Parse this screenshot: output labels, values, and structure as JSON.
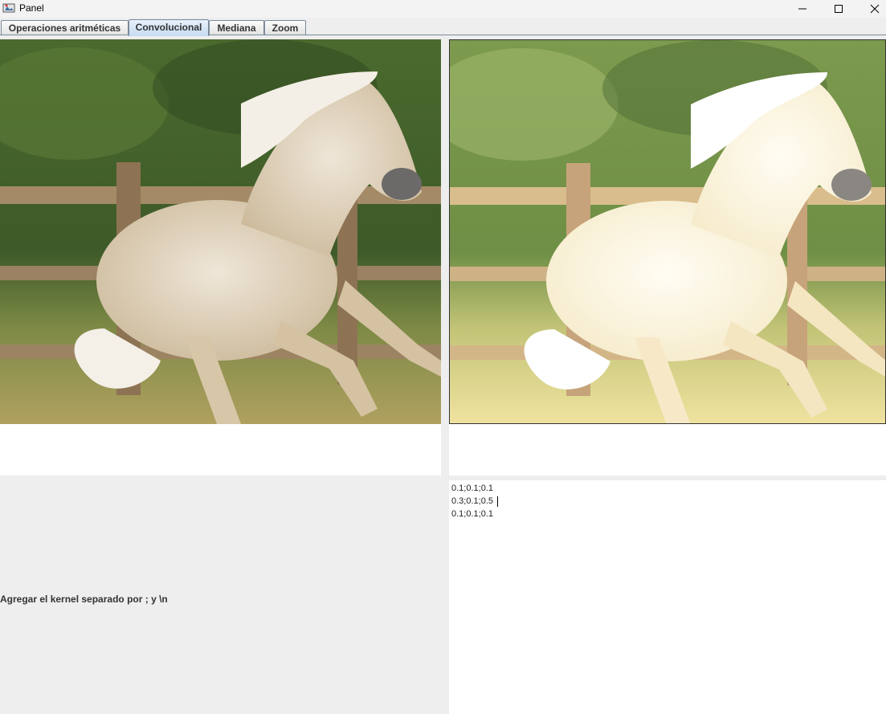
{
  "window": {
    "title": "Panel",
    "minimize_icon": "minimize-icon",
    "maximize_icon": "maximize-icon",
    "close_icon": "close-icon"
  },
  "tabs": [
    {
      "label": "Operaciones aritméticas",
      "active": false
    },
    {
      "label": "Convolucional",
      "active": true
    },
    {
      "label": "Mediana",
      "active": false
    },
    {
      "label": "Zoom",
      "active": false
    }
  ],
  "original_image": {
    "subject": "white horse running in a paddock with wooden fence",
    "state": "original"
  },
  "processed_image": {
    "subject": "white horse running in a paddock with wooden fence",
    "state": "brightened by convolution"
  },
  "kernel_label": "Agregar el kernel separado por ; y \\n",
  "kernel_text": {
    "lines": [
      "0.1;0.1;0.1",
      "0.3;0.1;0.5",
      "0.1;0.1;0.1"
    ]
  },
  "colors": {
    "tab_active": "#c6dbf1",
    "panel_bg": "#eeeeee",
    "text_area_bg": "#ffffff"
  }
}
